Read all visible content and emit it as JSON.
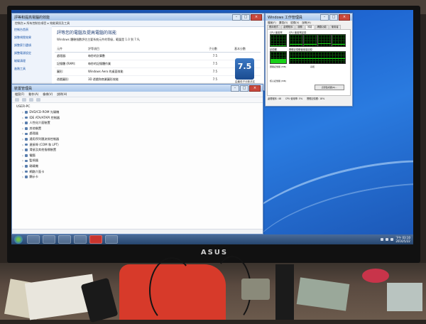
{
  "monitor": {
    "brand": "ASUS"
  },
  "perf": {
    "title": "評等和提高電腦的效能",
    "address": "控制台 ▸ 所有控制台項目 ▸ 效能資訊及工具",
    "side": [
      "控制台首頁",
      "調整視覺效果",
      "調整索引選項",
      "調整電源設定",
      "磁碟清理",
      "進階工具"
    ],
    "heading": "評等您的電腦及提高電腦的效能",
    "subheading": "Windows 體驗指數評估主要系統元件的等級，範圍是 1.0 到 7.9。",
    "columns": [
      "元件",
      "評等項目",
      "子分數",
      "基本分數"
    ],
    "rows": [
      {
        "c1": "處理器:",
        "c2": "每秒的計算數",
        "c3": "7.5"
      },
      {
        "c1": "記憶體 (RAM):",
        "c2": "每秒的記憶體作業",
        "c3": "7.5"
      },
      {
        "c1": "圖形:",
        "c2": "Windows Aero 的桌面效能",
        "c3": "7.5"
      },
      {
        "c1": "遊戲圖形:",
        "c2": "3D 遊戲和商業圖形效能",
        "c3": "7.5"
      },
      {
        "c1": "主要硬碟:",
        "c2": "磁碟資料傳輸速率",
        "c3": "7.5"
      }
    ],
    "score": "7.5",
    "score_caption": "由最低子分數決定"
  },
  "devmgr": {
    "title": "裝置管理員",
    "menu": [
      "檔案(F)",
      "動作(A)",
      "檢視(V)",
      "說明(H)"
    ],
    "root": "USER-PC",
    "items": [
      "DVD/CD-ROM 光碟機",
      "IDE ATA/ATAPI 控制器",
      "人性化介面裝置",
      "其他裝置",
      "處理器",
      "通用序列匯流排控制器",
      "連接埠 (COM 和 LPT)",
      "滑鼠及其他指標裝置",
      "電腦",
      "監視器",
      "磁碟機",
      "網路介面卡",
      "顯示卡"
    ]
  },
  "taskmgr": {
    "title": "Windows 工作管理員",
    "menu": [
      "檔案(F)",
      "選項(O)",
      "檢視(V)",
      "說明(H)"
    ],
    "tabs": [
      "應用程式",
      "處理程序",
      "服務",
      "效能",
      "網路功能",
      "使用者"
    ],
    "active_tab": 3,
    "cpu_usage_label": "CPU 使用率",
    "cpu_history_label": "CPU 使用率記錄",
    "mem_label": "記憶體",
    "mem_history_label": "實體記憶體使用量記錄",
    "cpu_percent": 5,
    "mem_fraction": 0.35,
    "physical_label": "實體記憶體 (MB)",
    "kernel_label": "核心記憶體 (MB)",
    "system_label": "系統",
    "resource_button": "資源監視器(R)...",
    "status": {
      "processes": "處理程序: 48",
      "cpu": "CPU 使用率: 5%",
      "memory": "實體記憶體: 18%"
    }
  },
  "taskbar": {
    "clock_time": "下午 03:10",
    "clock_date": "2016/5/22"
  }
}
